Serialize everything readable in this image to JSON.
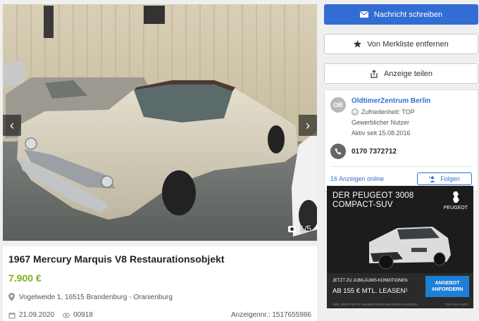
{
  "gallery": {
    "counter": "1/5",
    "prev_icon": "‹",
    "next_icon": "›"
  },
  "listing": {
    "title": "1967 Mercury Marquis V8 Restaurationsobjekt",
    "price": "7.900 €",
    "location": "Vogelweide 1, 16515 Brandenburg - Oranienburg",
    "date": "21.09.2020",
    "views": "00918",
    "ad_number": "Anzeigennr.: 1517655986"
  },
  "actions": {
    "message": "Nachricht schreiben",
    "watchlist": "Von Merkliste entfernen",
    "share": "Anzeige teilen"
  },
  "seller": {
    "initials": "OB",
    "name": "OldtimerZentrum Berlin",
    "satisfaction": "Zufriedenheit: TOP",
    "type": "Gewerblicher Nutzer",
    "active_since": "Aktiv seit 15.08.2016",
    "phone": "0170 7372712",
    "ads_online": "16 Anzeigen online",
    "follow": "Folgen"
  },
  "ad_banner": {
    "headline_1": "DER PEUGEOT 3008",
    "headline_2": "COMPACT-SUV",
    "brand": "PEUGEOT",
    "small": "JETZT ZU JUBILÄUMS-KONDITIONEN",
    "big": "AB 155 € MTL. LEASEN¹",
    "cta": "ANGEBOT ANFORDERN",
    "fine_left": "ABB. ZEIGT NICHT ANGEBOTENES BEISPIELFAHRZEUG",
    "fine_right": "¹ DETAILS HIER"
  },
  "colors": {
    "primary": "#326dd4",
    "price": "#7ab317"
  }
}
